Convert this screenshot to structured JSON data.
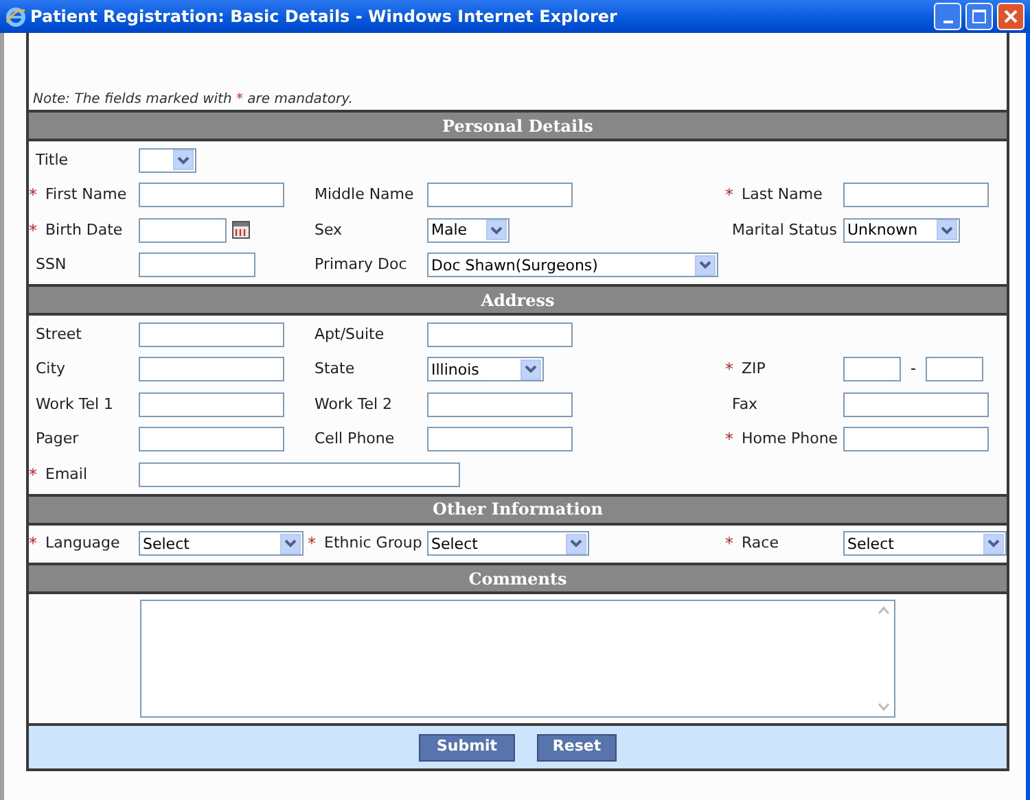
{
  "window": {
    "title": "Patient Registration: Basic Details - Windows Internet Explorer"
  },
  "note": {
    "before": "Note: The fields marked with",
    "mark": "*",
    "after": "are mandatory."
  },
  "sections": [
    {
      "kind": "fields",
      "title": "Personal Details",
      "rows": [
        [
          {
            "label": "Title",
            "kind": "select"
          }
        ],
        [
          {
            "label": "First Name",
            "kind": "text",
            "marker": "*"
          },
          {
            "label": "Middle Name",
            "kind": "text"
          },
          {
            "label": "Last Name",
            "kind": "text",
            "marker": "*"
          }
        ],
        [
          {
            "label": "Birth Date",
            "kind": "date",
            "marker": "*"
          },
          {
            "label": "Sex",
            "kind": "select",
            "value": "Male"
          },
          {
            "label": "Marital Status",
            "kind": "select",
            "value": "Unknown"
          }
        ],
        [
          {
            "label": "SSN",
            "kind": "text"
          },
          {
            "label": "Primary Doc",
            "kind": "select",
            "value": "Doc Shawn(Surgeons)"
          }
        ]
      ]
    },
    {
      "kind": "fields",
      "title": "Address",
      "rows": [
        [
          {
            "label": "Street",
            "kind": "text"
          },
          {
            "label": "Apt/Suite",
            "kind": "text"
          }
        ],
        [
          {
            "label": "City",
            "kind": "text"
          },
          {
            "label": "State",
            "kind": "select",
            "value": "Illinois"
          },
          {
            "label": "ZIP",
            "kind": "zip",
            "marker": "*",
            "separator": "-"
          }
        ],
        [
          {
            "label": "Work Tel 1",
            "kind": "text"
          },
          {
            "label": "Work Tel 2",
            "kind": "text"
          },
          {
            "label": "Fax",
            "kind": "text"
          }
        ],
        [
          {
            "label": "Pager",
            "kind": "text"
          },
          {
            "label": "Cell Phone",
            "kind": "text"
          },
          {
            "label": "Home Phone",
            "kind": "text",
            "marker": "*"
          }
        ],
        [
          {
            "label": "Email",
            "kind": "text",
            "marker": "*"
          }
        ]
      ]
    },
    {
      "kind": "fields",
      "title": "Other Information",
      "rows": [
        [
          {
            "label": "Language",
            "kind": "select",
            "value": "Select",
            "marker": "*"
          },
          {
            "label": "Ethnic Group",
            "kind": "select",
            "value": "Select",
            "marker": "*"
          },
          {
            "label": "Race",
            "kind": "select",
            "value": "Select",
            "marker": "*"
          }
        ]
      ]
    },
    {
      "kind": "comments",
      "title": "Comments"
    }
  ],
  "buttons": [
    "Submit",
    "Reset"
  ]
}
